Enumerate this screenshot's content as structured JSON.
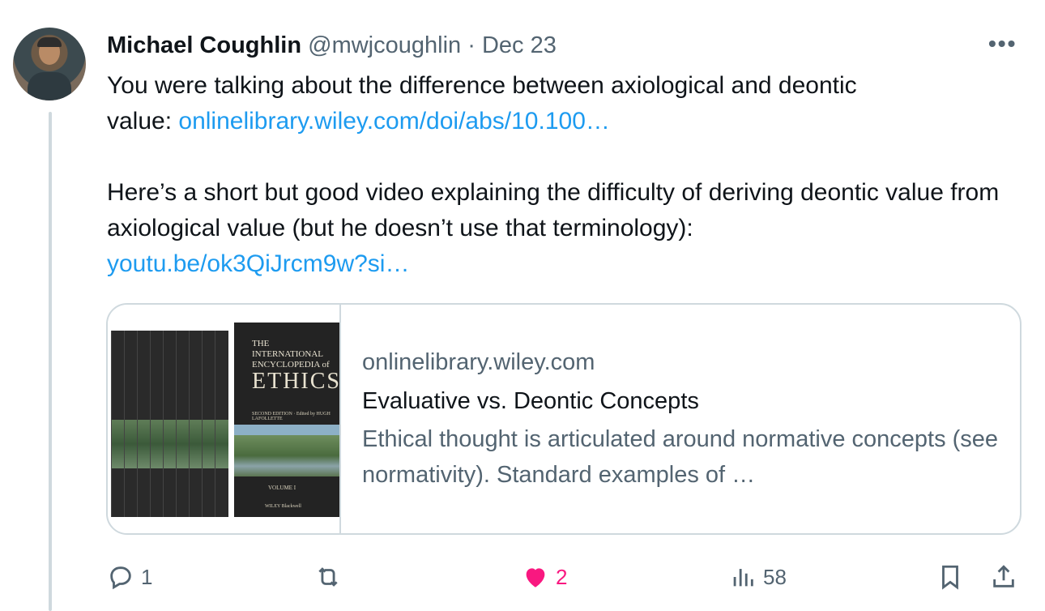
{
  "author": {
    "name": "Michael Coughlin",
    "handle": "@mwjcoughlin",
    "separator": "·",
    "date": "Dec 23"
  },
  "more_label": "•••",
  "tweet": {
    "line1": "You were talking about the difference between axiological and deontic",
    "line2_prefix": "value: ",
    "link1": "onlinelibrary.wiley.com/doi/abs/10.100…",
    "para2": "Here’s a short but good video explaining the difficulty of deriving deontic value from axiological value (but he doesn’t use that terminology):",
    "link2": "youtu.be/ok3QiJrcm9w?si…"
  },
  "card": {
    "domain": "onlinelibrary.wiley.com",
    "title": "Evaluative vs. Deontic Concepts",
    "description": "Ethical thought is articulated around normative concepts (see normativity). Standard examples of …",
    "image": {
      "title_small": "THE INTERNATIONAL ENCYCLOPEDIA of",
      "title_big": "ETHICS",
      "edition": "SECOND EDITION · Edited by HUGH LAFOLLETTE",
      "volume": "VOLUME I",
      "publisher": "WILEY Blackwell"
    }
  },
  "actions": {
    "replies": "1",
    "retweets": "",
    "likes": "2",
    "views": "58"
  },
  "colors": {
    "text": "#0f1419",
    "secondary": "#536471",
    "link": "#1d9bf0",
    "like": "#f91880",
    "border": "#cfd9de"
  }
}
